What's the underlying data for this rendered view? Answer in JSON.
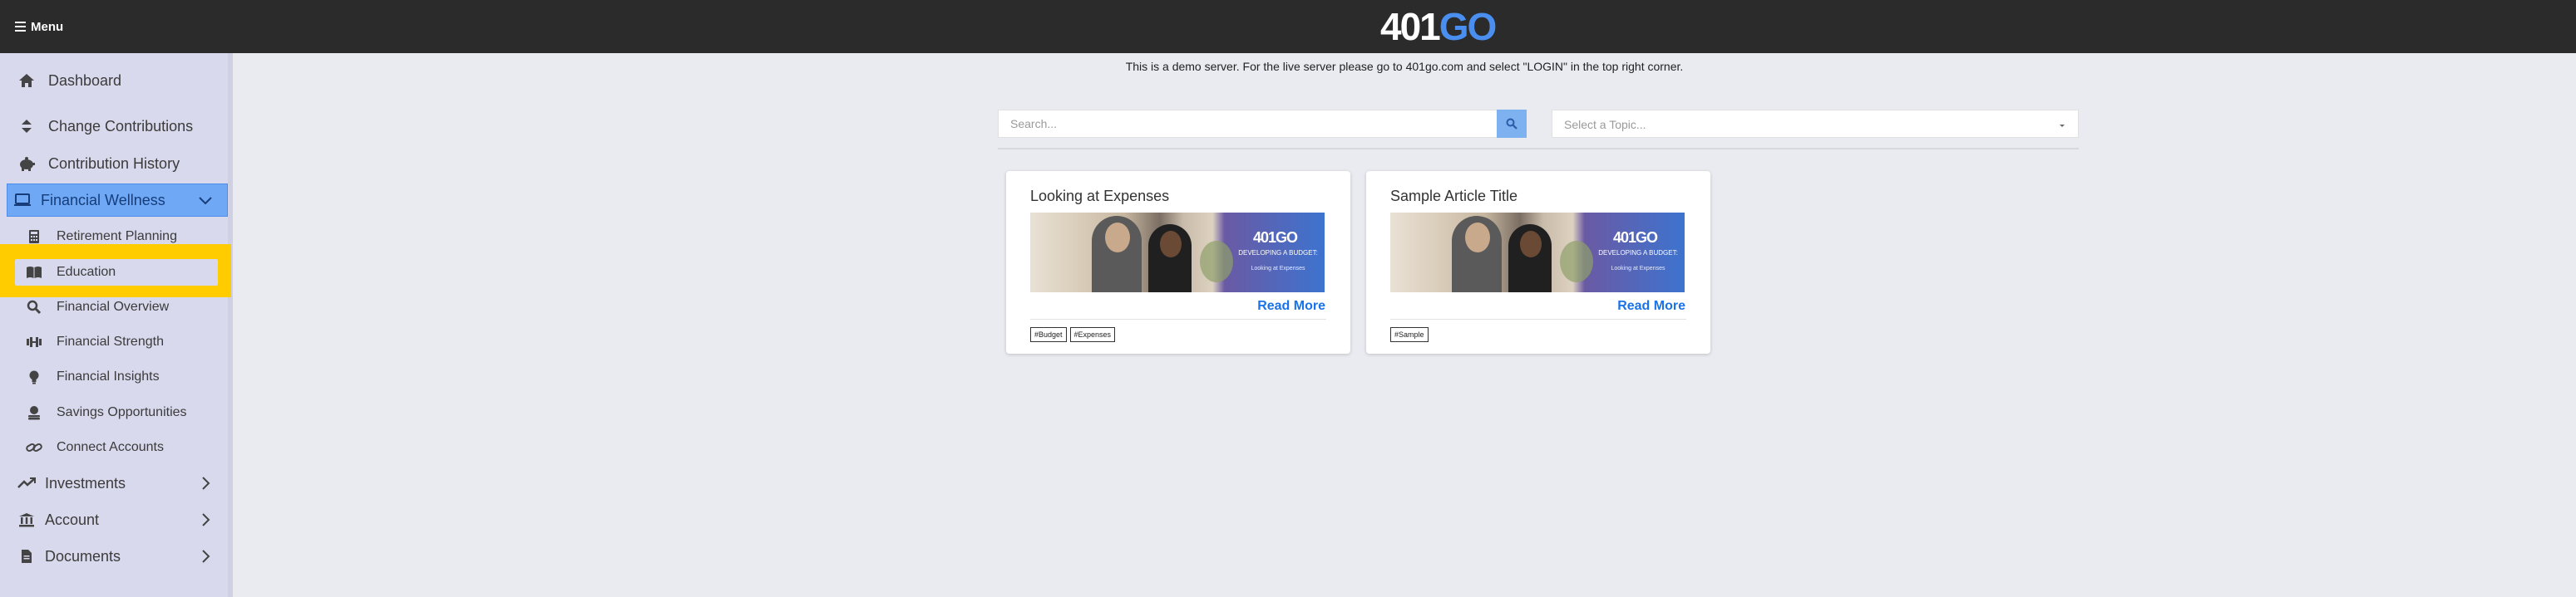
{
  "header": {
    "menu_label": "Menu",
    "logo_part1": "401",
    "logo_part2": "GO"
  },
  "sidebar": {
    "items": [
      {
        "label": "Dashboard",
        "icon": "home-icon"
      },
      {
        "label": "Change Contributions",
        "icon": "sort-icon"
      },
      {
        "label": "Contribution History",
        "icon": "piggy-bank-icon"
      },
      {
        "label": "Financial Wellness",
        "icon": "laptop-icon",
        "expanded": true
      },
      {
        "label": "Investments",
        "icon": "trend-icon"
      },
      {
        "label": "Account",
        "icon": "bank-icon"
      },
      {
        "label": "Documents",
        "icon": "document-icon"
      }
    ],
    "sub_items": [
      {
        "label": "Retirement Planning",
        "icon": "calculator-icon"
      },
      {
        "label": "Education",
        "icon": "book-icon"
      },
      {
        "label": "Financial Overview",
        "icon": "magnifier-icon"
      },
      {
        "label": "Financial Strength",
        "icon": "dumbbell-icon"
      },
      {
        "label": "Financial Insights",
        "icon": "lightbulb-icon"
      },
      {
        "label": "Savings Opportunities",
        "icon": "coins-icon"
      },
      {
        "label": "Connect Accounts",
        "icon": "link-icon"
      }
    ],
    "highlighted": "Education"
  },
  "main": {
    "notice": "This is a demo server. For the live server please go to 401go.com and select \"LOGIN\" in the top right corner.",
    "search_placeholder": "Search...",
    "topic_placeholder": "Select a Topic...",
    "articles": [
      {
        "title": "Looking at Expenses",
        "image_logo": "401GO",
        "image_caption": "DEVELOPING A BUDGET:",
        "image_subcaption": "Looking at Expenses",
        "read_more": "Read More",
        "tags": [
          "#Budget",
          "#Expenses"
        ]
      },
      {
        "title": "Sample Article Title",
        "image_logo": "401GO",
        "image_caption": "DEVELOPING A BUDGET:",
        "image_subcaption": "Looking at Expenses",
        "read_more": "Read More",
        "tags": [
          "#Sample"
        ]
      }
    ]
  },
  "colors": {
    "topbar": "#2b2b2b",
    "sidebar": "#d8d9ec",
    "active_item": "#6fa8f4",
    "highlight": "#ffcc00",
    "link": "#1a73e8",
    "background": "#e9ebf0"
  }
}
